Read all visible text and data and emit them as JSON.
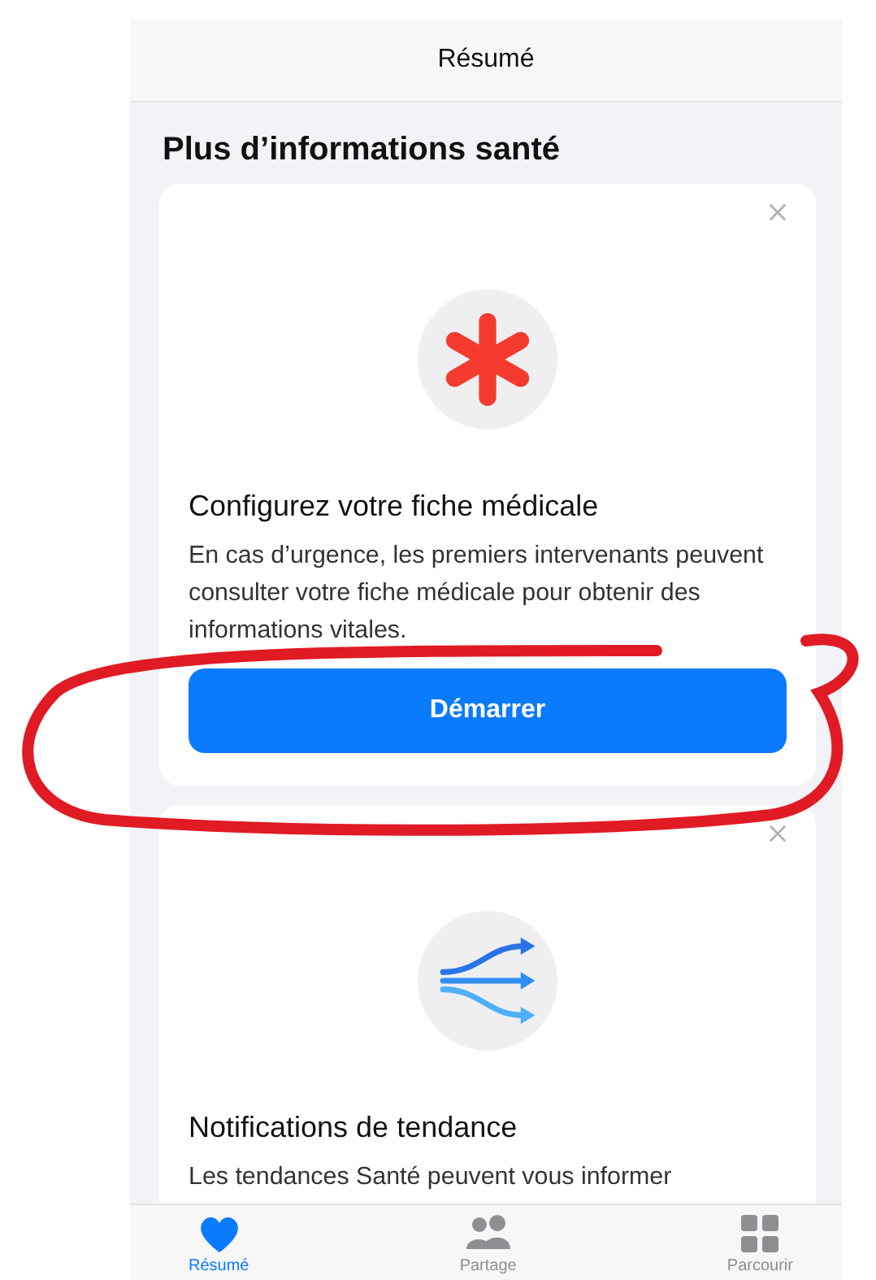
{
  "nav_bar": {
    "title": "Résumé"
  },
  "section_title": "Plus d’informations santé",
  "cards": [
    {
      "kind": "medical-id",
      "title": "Configurez votre fiche médicale",
      "body": "En cas d’urgence, les premiers intervenants peuvent consulter votre fiche médicale pour obtenir des informations vitales.",
      "button": "Démarrer"
    },
    {
      "kind": "trends",
      "title": "Notifications de tendance",
      "body": "Les tendances Santé peuvent vous informer"
    }
  ],
  "tab_bar": [
    {
      "kind": "heart",
      "label": "Résumé",
      "selected": true
    },
    {
      "kind": "people",
      "label": "Partage",
      "selected": false
    },
    {
      "kind": "grid",
      "label": "Parcourir",
      "selected": false
    }
  ]
}
